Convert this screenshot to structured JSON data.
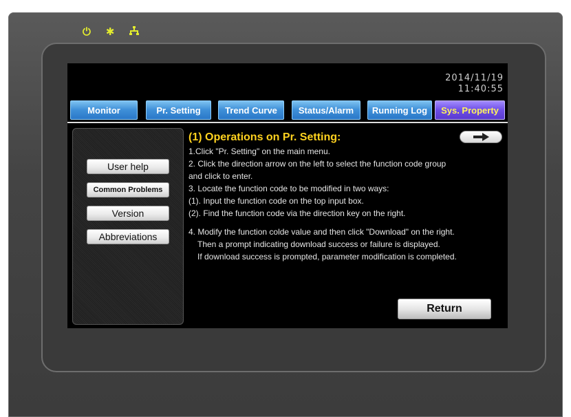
{
  "indicators": [
    "power-icon",
    "star-icon",
    "network-icon"
  ],
  "datetime": {
    "date": "2014/11/19",
    "time": "11:40:55"
  },
  "tabs": [
    {
      "label": "Monitor"
    },
    {
      "label": "Pr. Setting"
    },
    {
      "label": "Trend Curve"
    },
    {
      "label": "Status/Alarm"
    },
    {
      "label": "Running Log"
    },
    {
      "label": "Sys. Property",
      "active": true
    }
  ],
  "sidebar": {
    "user_help": "User help",
    "common_problems": "Common Problems",
    "version": "Version",
    "abbreviations": "Abbreviations"
  },
  "content": {
    "heading": "(1) Operations on Pr. Setting:",
    "lines": [
      "1.Click \"Pr. Setting\" on the main menu.",
      "2. Click the direction arrow on the left to select the function code group",
      "and click to enter.",
      "3. Locate the function code to be modified in two ways:",
      "(1). Input the function code on the top input box.",
      "(2). Find the function code via the direction key on the right.",
      "4. Modify the function colde value and then click \"Download\" on the right.",
      "Then a prompt indicating download success or failure is displayed.",
      "If download success is prompted, parameter modification is completed."
    ]
  },
  "buttons": {
    "next_icon": "arrow-right-icon",
    "return_label": "Return"
  },
  "colors": {
    "heading": "#ffd21f",
    "tab_blue": "#3f90d8",
    "tab_active": "#6e4ee6",
    "tab_active_text": "#fff45a",
    "led": "#e3ec2e"
  }
}
